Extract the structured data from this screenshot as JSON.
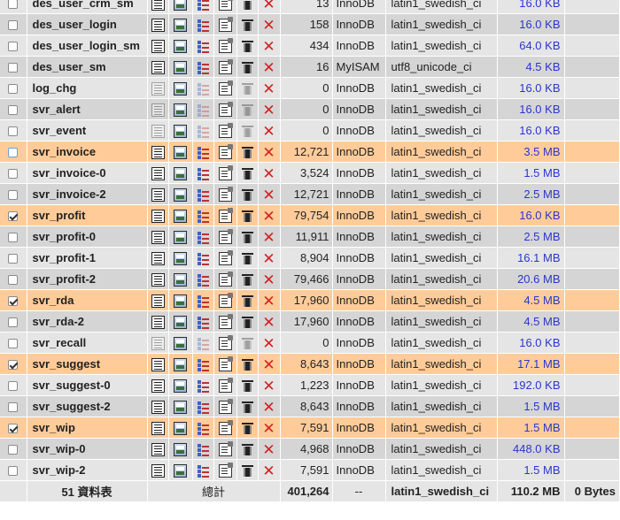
{
  "rows": [
    {
      "name": "des_user_crm_sm",
      "rows": "13",
      "engine": "InnoDB",
      "collation": "latin1_swedish_ci",
      "size": "16.0 KB",
      "checked": false,
      "state": "normal",
      "empty_enabled": true
    },
    {
      "name": "des_user_login",
      "rows": "158",
      "engine": "InnoDB",
      "collation": "latin1_swedish_ci",
      "size": "16.0 KB",
      "checked": false,
      "state": "normal",
      "empty_enabled": true
    },
    {
      "name": "des_user_login_sm",
      "rows": "434",
      "engine": "InnoDB",
      "collation": "latin1_swedish_ci",
      "size": "64.0 KB",
      "checked": false,
      "state": "normal",
      "empty_enabled": true
    },
    {
      "name": "des_user_sm",
      "rows": "16",
      "engine": "MyISAM",
      "collation": "utf8_unicode_ci",
      "size": "4.5 KB",
      "checked": false,
      "state": "normal",
      "empty_enabled": true
    },
    {
      "name": "log_chg",
      "rows": "0",
      "engine": "InnoDB",
      "collation": "latin1_swedish_ci",
      "size": "16.0 KB",
      "checked": false,
      "state": "normal",
      "empty_enabled": false
    },
    {
      "name": "svr_alert",
      "rows": "0",
      "engine": "InnoDB",
      "collation": "latin1_swedish_ci",
      "size": "16.0 KB",
      "checked": false,
      "state": "normal",
      "empty_enabled": false
    },
    {
      "name": "svr_event",
      "rows": "0",
      "engine": "InnoDB",
      "collation": "latin1_swedish_ci",
      "size": "16.0 KB",
      "checked": false,
      "state": "normal",
      "empty_enabled": false
    },
    {
      "name": "svr_invoice",
      "rows": "12,721",
      "engine": "InnoDB",
      "collation": "latin1_swedish_ci",
      "size": "3.5 MB",
      "checked": false,
      "state": "hover",
      "empty_enabled": true
    },
    {
      "name": "svr_invoice-0",
      "rows": "3,524",
      "engine": "InnoDB",
      "collation": "latin1_swedish_ci",
      "size": "1.5 MB",
      "checked": false,
      "state": "normal",
      "empty_enabled": true
    },
    {
      "name": "svr_invoice-2",
      "rows": "12,721",
      "engine": "InnoDB",
      "collation": "latin1_swedish_ci",
      "size": "2.5 MB",
      "checked": false,
      "state": "normal",
      "empty_enabled": true
    },
    {
      "name": "svr_profit",
      "rows": "79,754",
      "engine": "InnoDB",
      "collation": "latin1_swedish_ci",
      "size": "16.0 KB",
      "checked": true,
      "state": "marked",
      "empty_enabled": true
    },
    {
      "name": "svr_profit-0",
      "rows": "11,911",
      "engine": "InnoDB",
      "collation": "latin1_swedish_ci",
      "size": "2.5 MB",
      "checked": false,
      "state": "normal",
      "empty_enabled": true
    },
    {
      "name": "svr_profit-1",
      "rows": "8,904",
      "engine": "InnoDB",
      "collation": "latin1_swedish_ci",
      "size": "16.1 MB",
      "checked": false,
      "state": "normal",
      "empty_enabled": true
    },
    {
      "name": "svr_profit-2",
      "rows": "79,466",
      "engine": "InnoDB",
      "collation": "latin1_swedish_ci",
      "size": "20.6 MB",
      "checked": false,
      "state": "normal",
      "empty_enabled": true
    },
    {
      "name": "svr_rda",
      "rows": "17,960",
      "engine": "InnoDB",
      "collation": "latin1_swedish_ci",
      "size": "4.5 MB",
      "checked": true,
      "state": "marked",
      "empty_enabled": true
    },
    {
      "name": "svr_rda-2",
      "rows": "17,960",
      "engine": "InnoDB",
      "collation": "latin1_swedish_ci",
      "size": "4.5 MB",
      "checked": false,
      "state": "normal",
      "empty_enabled": true
    },
    {
      "name": "svr_recall",
      "rows": "0",
      "engine": "InnoDB",
      "collation": "latin1_swedish_ci",
      "size": "16.0 KB",
      "checked": false,
      "state": "normal",
      "empty_enabled": false
    },
    {
      "name": "svr_suggest",
      "rows": "8,643",
      "engine": "InnoDB",
      "collation": "latin1_swedish_ci",
      "size": "17.1 MB",
      "checked": true,
      "state": "marked",
      "empty_enabled": true
    },
    {
      "name": "svr_suggest-0",
      "rows": "1,223",
      "engine": "InnoDB",
      "collation": "latin1_swedish_ci",
      "size": "192.0 KB",
      "checked": false,
      "state": "normal",
      "empty_enabled": true
    },
    {
      "name": "svr_suggest-2",
      "rows": "8,643",
      "engine": "InnoDB",
      "collation": "latin1_swedish_ci",
      "size": "1.5 MB",
      "checked": false,
      "state": "normal",
      "empty_enabled": true
    },
    {
      "name": "svr_wip",
      "rows": "7,591",
      "engine": "InnoDB",
      "collation": "latin1_swedish_ci",
      "size": "1.5 MB",
      "checked": true,
      "state": "marked",
      "empty_enabled": true
    },
    {
      "name": "svr_wip-0",
      "rows": "4,968",
      "engine": "InnoDB",
      "collation": "latin1_swedish_ci",
      "size": "448.0 KB",
      "checked": false,
      "state": "normal",
      "empty_enabled": true
    },
    {
      "name": "svr_wip-2",
      "rows": "7,591",
      "engine": "InnoDB",
      "collation": "latin1_swedish_ci",
      "size": "1.5 MB",
      "checked": false,
      "state": "normal",
      "empty_enabled": true
    }
  ],
  "footer": {
    "table_count": "51 資料表",
    "sum_label": "總計",
    "total_rows": "401,264",
    "engine": "--",
    "collation": "latin1_swedish_ci",
    "total_size": "110.2 MB",
    "overhead": "0 Bytes"
  },
  "icons": {
    "browse": "browse-icon",
    "structure": "structure-icon",
    "search": "search-icon",
    "insert": "insert-icon",
    "empty": "empty-table-icon",
    "drop": "drop-table-icon"
  },
  "colors": {
    "row_even": "#e5e5e5",
    "row_odd": "#d5d5d5",
    "row_marked": "#ffcc99",
    "size_link": "#2a36cc",
    "drop": "#d42020"
  }
}
